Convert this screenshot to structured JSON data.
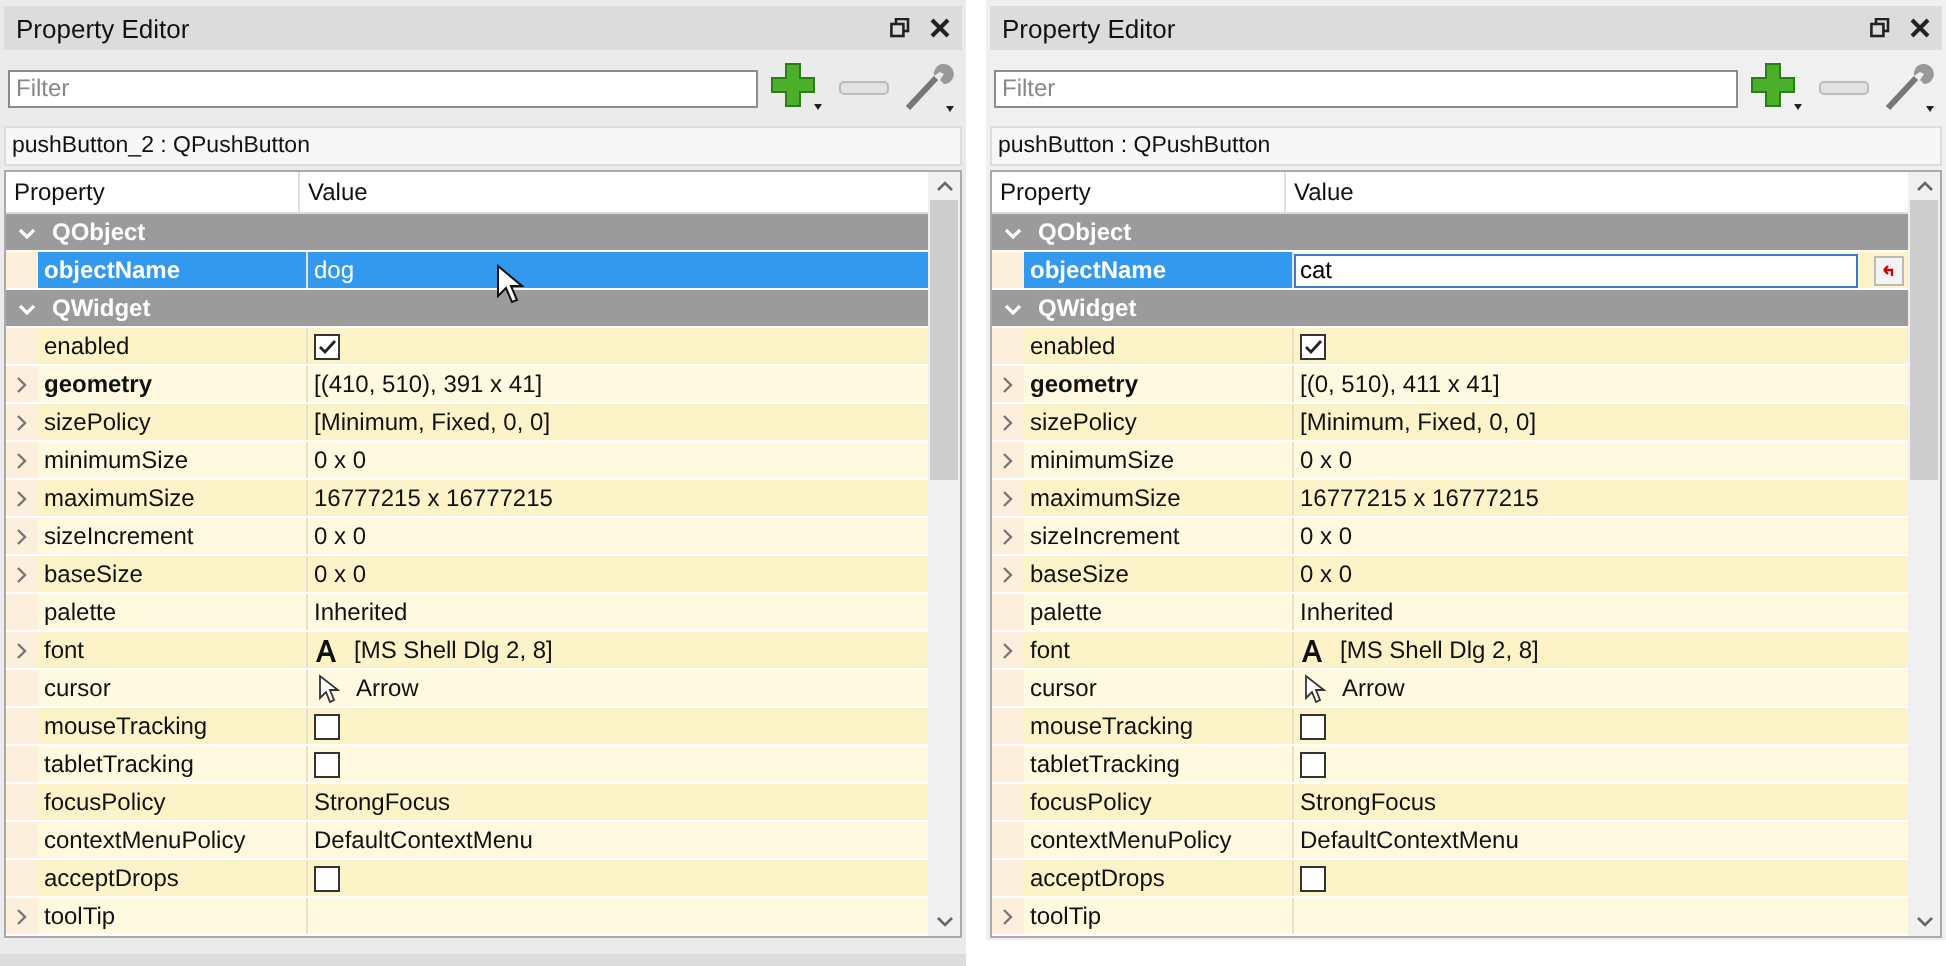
{
  "panels": [
    {
      "title": "Property Editor",
      "filter": {
        "placeholder": "Filter"
      },
      "object_label": "pushButton_2 : QPushButton",
      "columns": [
        "Property",
        "Value"
      ],
      "mouse_pointer": true,
      "rows": [
        {
          "kind": "group",
          "name": "QObject",
          "expanded": true,
          "selected": false
        },
        {
          "kind": "text",
          "name": "objectName",
          "value": "dog",
          "expandable": false,
          "modified": true,
          "selected": true,
          "editing": false
        },
        {
          "kind": "group",
          "name": "QWidget",
          "expanded": true,
          "selected": false
        },
        {
          "kind": "checkbox",
          "name": "enabled",
          "checked": true,
          "expandable": false,
          "modified": false,
          "selected": false,
          "editing": false
        },
        {
          "kind": "text",
          "name": "geometry",
          "value": "[(410, 510), 391 x 41]",
          "expandable": true,
          "modified": true,
          "selected": false,
          "editing": false
        },
        {
          "kind": "text",
          "name": "sizePolicy",
          "value": "[Minimum, Fixed, 0, 0]",
          "expandable": true,
          "modified": false,
          "selected": false,
          "editing": false
        },
        {
          "kind": "text",
          "name": "minimumSize",
          "value": "0 x 0",
          "expandable": true,
          "modified": false,
          "selected": false,
          "editing": false
        },
        {
          "kind": "text",
          "name": "maximumSize",
          "value": "16777215 x 16777215",
          "expandable": true,
          "modified": false,
          "selected": false,
          "editing": false
        },
        {
          "kind": "text",
          "name": "sizeIncrement",
          "value": "0 x 0",
          "expandable": true,
          "modified": false,
          "selected": false,
          "editing": false
        },
        {
          "kind": "text",
          "name": "baseSize",
          "value": "0 x 0",
          "expandable": true,
          "modified": false,
          "selected": false,
          "editing": false
        },
        {
          "kind": "text",
          "name": "palette",
          "value": "Inherited",
          "expandable": false,
          "modified": false,
          "selected": false,
          "editing": false
        },
        {
          "kind": "font",
          "name": "font",
          "value": "[MS Shell Dlg 2, 8]",
          "expandable": true,
          "modified": false,
          "selected": false,
          "editing": false
        },
        {
          "kind": "cursor",
          "name": "cursor",
          "value": "Arrow",
          "expandable": false,
          "modified": false,
          "selected": false,
          "editing": false
        },
        {
          "kind": "checkbox",
          "name": "mouseTracking",
          "checked": false,
          "expandable": false,
          "modified": false,
          "selected": false,
          "editing": false
        },
        {
          "kind": "checkbox",
          "name": "tabletTracking",
          "checked": false,
          "expandable": false,
          "modified": false,
          "selected": false,
          "editing": false
        },
        {
          "kind": "text",
          "name": "focusPolicy",
          "value": "StrongFocus",
          "expandable": false,
          "modified": false,
          "selected": false,
          "editing": false
        },
        {
          "kind": "text",
          "name": "contextMenuPolicy",
          "value": "DefaultContextMenu",
          "expandable": false,
          "modified": false,
          "selected": false,
          "editing": false
        },
        {
          "kind": "checkbox",
          "name": "acceptDrops",
          "checked": false,
          "expandable": false,
          "modified": false,
          "selected": false,
          "editing": false
        },
        {
          "kind": "text",
          "name": "toolTip",
          "value": null,
          "expandable": true,
          "modified": false,
          "selected": false,
          "editing": false
        }
      ]
    },
    {
      "title": "Property Editor",
      "filter": {
        "placeholder": "Filter"
      },
      "object_label": "pushButton : QPushButton",
      "columns": [
        "Property",
        "Value"
      ],
      "mouse_pointer": false,
      "rows": [
        {
          "kind": "group",
          "name": "QObject",
          "expanded": true,
          "selected": false
        },
        {
          "kind": "text",
          "name": "objectName",
          "value": "cat",
          "expandable": false,
          "modified": true,
          "selected": true,
          "editing": true
        },
        {
          "kind": "group",
          "name": "QWidget",
          "expanded": true,
          "selected": false
        },
        {
          "kind": "checkbox",
          "name": "enabled",
          "checked": true,
          "expandable": false,
          "modified": false,
          "selected": false,
          "editing": false
        },
        {
          "kind": "text",
          "name": "geometry",
          "value": "[(0, 510), 411 x 41]",
          "expandable": true,
          "modified": true,
          "selected": false,
          "editing": false
        },
        {
          "kind": "text",
          "name": "sizePolicy",
          "value": "[Minimum, Fixed, 0, 0]",
          "expandable": true,
          "modified": false,
          "selected": false,
          "editing": false
        },
        {
          "kind": "text",
          "name": "minimumSize",
          "value": "0 x 0",
          "expandable": true,
          "modified": false,
          "selected": false,
          "editing": false
        },
        {
          "kind": "text",
          "name": "maximumSize",
          "value": "16777215 x 16777215",
          "expandable": true,
          "modified": false,
          "selected": false,
          "editing": false
        },
        {
          "kind": "text",
          "name": "sizeIncrement",
          "value": "0 x 0",
          "expandable": true,
          "modified": false,
          "selected": false,
          "editing": false
        },
        {
          "kind": "text",
          "name": "baseSize",
          "value": "0 x 0",
          "expandable": true,
          "modified": false,
          "selected": false,
          "editing": false
        },
        {
          "kind": "text",
          "name": "palette",
          "value": "Inherited",
          "expandable": false,
          "modified": false,
          "selected": false,
          "editing": false
        },
        {
          "kind": "font",
          "name": "font",
          "value": "[MS Shell Dlg 2, 8]",
          "expandable": true,
          "modified": false,
          "selected": false,
          "editing": false
        },
        {
          "kind": "cursor",
          "name": "cursor",
          "value": "Arrow",
          "expandable": false,
          "modified": false,
          "selected": false,
          "editing": false
        },
        {
          "kind": "checkbox",
          "name": "mouseTracking",
          "checked": false,
          "expandable": false,
          "modified": false,
          "selected": false,
          "editing": false
        },
        {
          "kind": "checkbox",
          "name": "tabletTracking",
          "checked": false,
          "expandable": false,
          "modified": false,
          "selected": false,
          "editing": false
        },
        {
          "kind": "text",
          "name": "focusPolicy",
          "value": "StrongFocus",
          "expandable": false,
          "modified": false,
          "selected": false,
          "editing": false
        },
        {
          "kind": "text",
          "name": "contextMenuPolicy",
          "value": "DefaultContextMenu",
          "expandable": false,
          "modified": false,
          "selected": false,
          "editing": false
        },
        {
          "kind": "checkbox",
          "name": "acceptDrops",
          "checked": false,
          "expandable": false,
          "modified": false,
          "selected": false,
          "editing": false
        },
        {
          "kind": "text",
          "name": "toolTip",
          "value": null,
          "expandable": true,
          "modified": false,
          "selected": false,
          "editing": false
        }
      ]
    }
  ]
}
